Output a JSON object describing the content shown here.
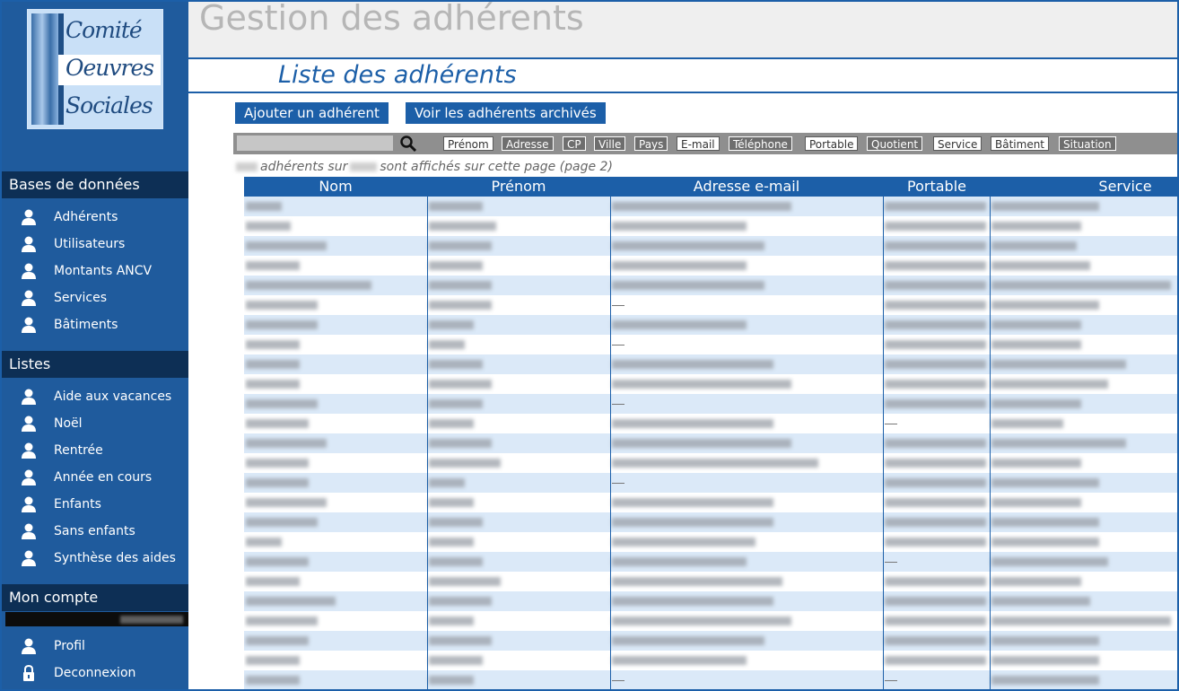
{
  "app": {
    "title": "Gestion des adhérents"
  },
  "page": {
    "title": "Liste des adhérents"
  },
  "logo": {
    "line1": "Comité",
    "line2": "Oeuvres",
    "line3": "Sociales"
  },
  "sidebar": {
    "sections": [
      {
        "title": "Bases de données",
        "items": [
          {
            "label": "Adhérents",
            "icon": "user-icon"
          },
          {
            "label": "Utilisateurs",
            "icon": "user-icon"
          },
          {
            "label": "Montants ANCV",
            "icon": "user-icon"
          },
          {
            "label": "Services",
            "icon": "user-icon"
          },
          {
            "label": "Bâtiments",
            "icon": "user-icon"
          }
        ]
      },
      {
        "title": "Listes",
        "items": [
          {
            "label": "Aide aux vacances",
            "icon": "user-icon"
          },
          {
            "label": "Noël",
            "icon": "user-icon"
          },
          {
            "label": "Rentrée",
            "icon": "user-icon"
          },
          {
            "label": "Année en cours",
            "icon": "user-icon"
          },
          {
            "label": "Enfants",
            "icon": "user-icon"
          },
          {
            "label": "Sans enfants",
            "icon": "user-icon"
          },
          {
            "label": "Synthèse des aides",
            "icon": "user-icon"
          }
        ]
      },
      {
        "title": "Mon compte",
        "items": [
          {
            "label": "Profil",
            "icon": "user-icon"
          },
          {
            "label": "Deconnexion",
            "icon": "lock-icon"
          }
        ]
      }
    ]
  },
  "actions": {
    "add": "Ajouter un adhérent",
    "archived": "Voir les adhérents archivés"
  },
  "filters": {
    "search_value": "",
    "columns": [
      {
        "label": "Prénom",
        "active": false
      },
      {
        "label": "Adresse",
        "active": true
      },
      {
        "label": "CP",
        "active": true
      },
      {
        "label": "Ville",
        "active": true
      },
      {
        "label": "Pays",
        "active": true
      },
      {
        "label": "E-mail",
        "active": false
      },
      {
        "label": "Téléphone",
        "active": true
      },
      {
        "label": "Portable",
        "active": false
      },
      {
        "label": "Quotient",
        "active": true
      },
      {
        "label": "Service",
        "active": false
      },
      {
        "label": "Bâtiment",
        "active": false
      },
      {
        "label": "Situation",
        "active": true
      }
    ]
  },
  "info": {
    "part1": "adhérents sur",
    "part2": "sont affichés sur cette page (page 2)"
  },
  "table": {
    "columns": [
      "Nom",
      "Prénom",
      "Adresse e-mail",
      "Portable",
      "Service"
    ],
    "row_count": 25
  },
  "colors": {
    "primary": "#1c5fa8",
    "sidebar": "#1f5b9d",
    "section": "#0d2f55",
    "row_alt": "#dbe9f8"
  }
}
